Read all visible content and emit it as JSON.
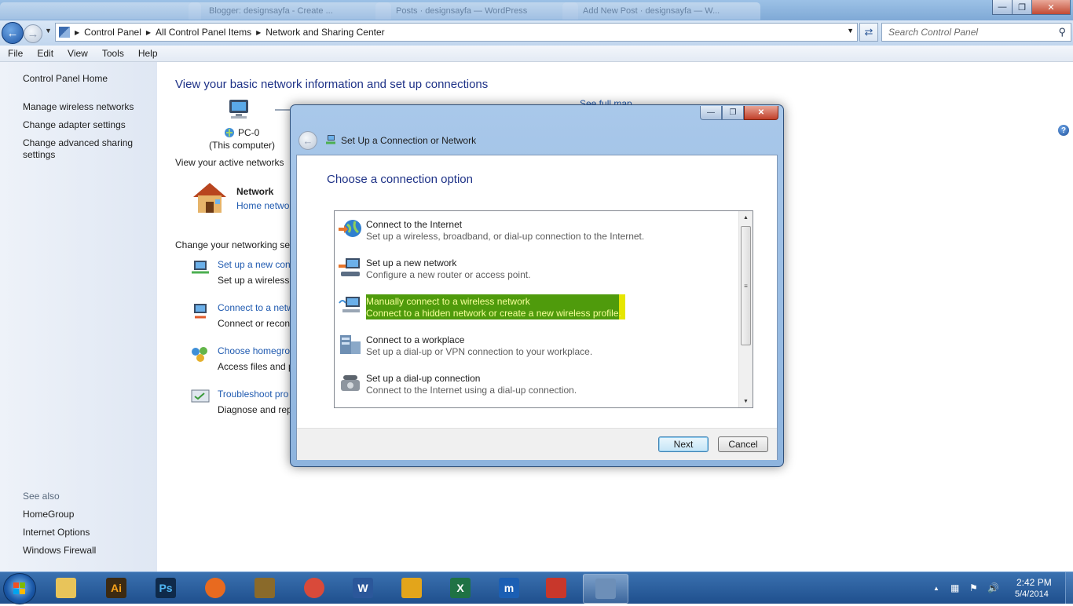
{
  "browser_tabs": [
    "Blogger: designsayfa - Create ...",
    "Posts · designsayfa — WordPress",
    "Add New Post · designsayfa — W..."
  ],
  "address": {
    "crumbs": [
      "Control Panel",
      "All Control Panel Items",
      "Network and Sharing Center"
    ],
    "search_placeholder": "Search Control Panel"
  },
  "menu": [
    "File",
    "Edit",
    "View",
    "Tools",
    "Help"
  ],
  "left_pane": {
    "home": "Control Panel Home",
    "links": [
      "Manage wireless networks",
      "Change adapter settings",
      "Change advanced sharing settings"
    ],
    "see_also_label": "See also",
    "see_also": [
      "HomeGroup",
      "Internet Options",
      "Windows Firewall"
    ]
  },
  "main": {
    "title": "View your basic network information and set up connections",
    "see_full_map": "See full map",
    "computer_name": "PC-0",
    "computer_sub": "(This computer)",
    "active_networks_label": "View your active networks",
    "network_name": "Network",
    "network_type": "Home netwo",
    "change_settings_label": "Change your networking se",
    "tasks": [
      {
        "link": "Set up a new conn",
        "desc": "Set up a wireless, "
      },
      {
        "link": "Connect to a netw",
        "desc": "Connect or recon"
      },
      {
        "link": "Choose homegro",
        "desc": "Access files and p"
      },
      {
        "link": "Troubleshoot pro",
        "desc": "Diagnose and rep"
      }
    ]
  },
  "dialog": {
    "window_title": "Set Up a Connection or Network",
    "heading": "Choose a connection option",
    "options": [
      {
        "title": "Connect to the Internet",
        "desc": "Set up a wireless, broadband, or dial-up connection to the Internet.",
        "icon": "globe-icon"
      },
      {
        "title": "Set up a new network",
        "desc": "Configure a new router or access point.",
        "icon": "router-icon"
      },
      {
        "title": "Manually connect to a wireless network",
        "desc": "Connect to a hidden network or create a new wireless profile.",
        "icon": "wireless-computer-icon",
        "highlighted": true
      },
      {
        "title": "Connect to a workplace",
        "desc": "Set up a dial-up or VPN connection to your workplace.",
        "icon": "workplace-icon"
      },
      {
        "title": "Set up a dial-up connection",
        "desc": "Connect to the Internet using a dial-up connection.",
        "icon": "telephone-icon"
      }
    ],
    "next_label": "Next",
    "cancel_label": "Cancel",
    "highlight_color": "#4f9b0c"
  },
  "taskbar": {
    "apps": [
      {
        "name": "windows-explorer-icon",
        "glyph": "",
        "color": "#e8c45a"
      },
      {
        "name": "illustrator-icon",
        "glyph": "Ai",
        "color": "#3c2a12"
      },
      {
        "name": "photoshop-icon",
        "glyph": "Ps",
        "color": "#0f2a4a"
      },
      {
        "name": "firefox-icon",
        "glyph": "",
        "color": "#e86a1f"
      },
      {
        "name": "game-icon",
        "glyph": "",
        "color": "#8a6a2a"
      },
      {
        "name": "chrome-icon",
        "glyph": "",
        "color": "#d94a3a"
      },
      {
        "name": "word-icon",
        "glyph": "W",
        "color": "#2b579a"
      },
      {
        "name": "winamp-icon",
        "glyph": "",
        "color": "#e3a51b"
      },
      {
        "name": "excel-icon",
        "glyph": "X",
        "color": "#1f7244"
      },
      {
        "name": "maxthon-icon",
        "glyph": "m",
        "color": "#1b5fb4"
      },
      {
        "name": "pdf-icon",
        "glyph": "",
        "color": "#c8372b"
      },
      {
        "name": "control-panel-icon",
        "glyph": "",
        "color": "#6d8fb8"
      }
    ],
    "time": "2:42 PM",
    "date": "5/4/2014"
  }
}
